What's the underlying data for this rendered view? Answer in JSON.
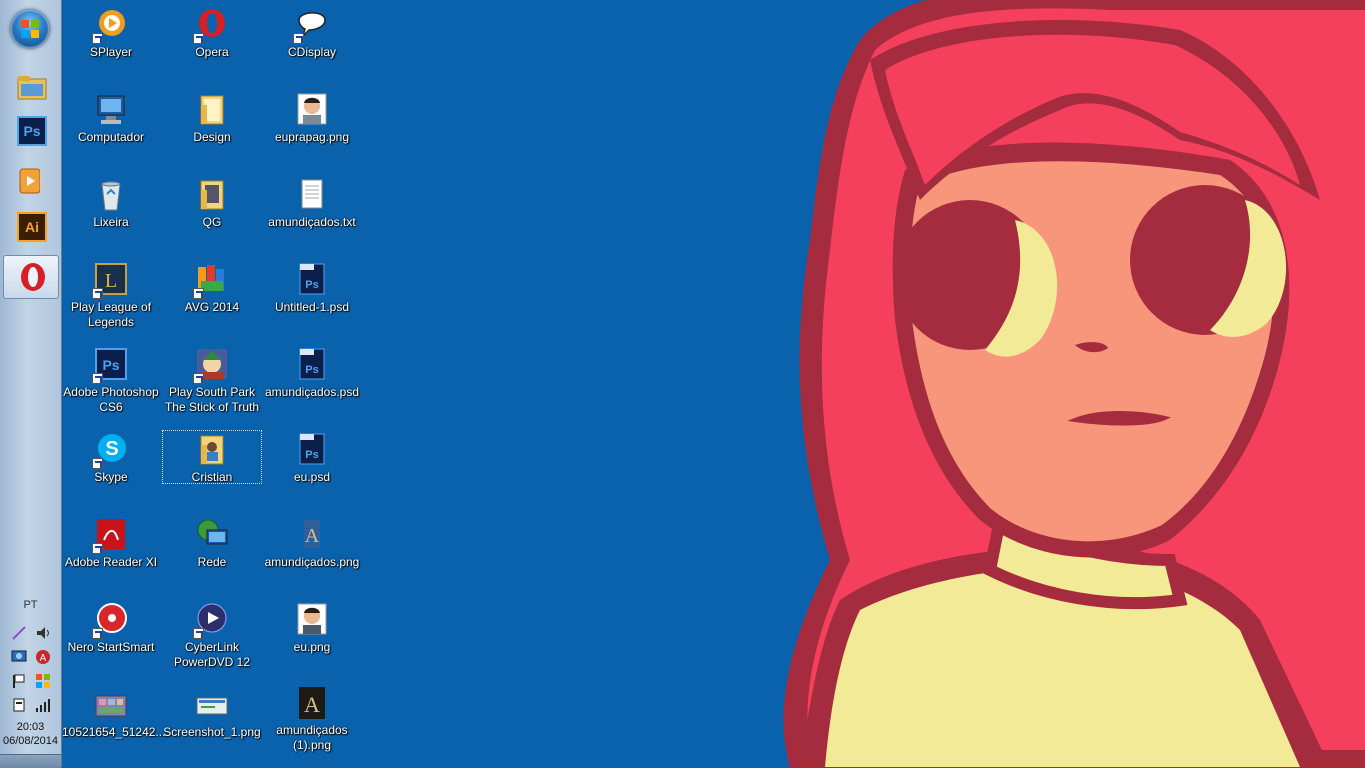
{
  "taskbar": {
    "pinned": [
      {
        "name": "explorer",
        "icon": "folder-icon"
      },
      {
        "name": "photoshop",
        "icon": "photoshop-icon",
        "glyph": "Ps"
      },
      {
        "name": "media-player",
        "icon": "media-player-icon"
      },
      {
        "name": "illustrator",
        "icon": "illustrator-icon",
        "glyph": "Ai"
      },
      {
        "name": "opera",
        "icon": "opera-icon",
        "glyph": "O"
      }
    ],
    "language": "PT",
    "clock": {
      "time": "20:03",
      "date": "06/08/2014"
    }
  },
  "desktop": {
    "icons": [
      {
        "label": "SPlayer",
        "icon": "splayer-icon",
        "shortcut": true
      },
      {
        "label": "Computador",
        "icon": "computer-icon",
        "shortcut": false
      },
      {
        "label": "Lixeira",
        "icon": "recycle-bin-icon",
        "shortcut": false
      },
      {
        "label": "Play League of Legends",
        "icon": "league-of-legends-icon",
        "shortcut": true
      },
      {
        "label": "Adobe Photoshop CS6",
        "icon": "photoshop-icon",
        "shortcut": true
      },
      {
        "label": "Skype",
        "icon": "skype-icon",
        "shortcut": true
      },
      {
        "label": "Adobe Reader XI",
        "icon": "adobe-reader-icon",
        "shortcut": true
      },
      {
        "label": "Nero StartSmart",
        "icon": "nero-icon",
        "shortcut": true
      },
      {
        "label": "10521654_51242...",
        "icon": "image-file-icon",
        "shortcut": false
      },
      {
        "label": "Opera",
        "icon": "opera-icon",
        "shortcut": true
      },
      {
        "label": "Design",
        "icon": "folder-icon",
        "shortcut": false
      },
      {
        "label": "QG",
        "icon": "folder-icon",
        "shortcut": false
      },
      {
        "label": "AVG 2014",
        "icon": "avg-icon",
        "shortcut": true
      },
      {
        "label": "Play South Park The Stick of Truth",
        "icon": "south-park-icon",
        "shortcut": true
      },
      {
        "label": "Cristian",
        "icon": "user-folder-icon",
        "shortcut": false,
        "selected": true
      },
      {
        "label": "Rede",
        "icon": "network-icon",
        "shortcut": false
      },
      {
        "label": "CyberLink PowerDVD 12",
        "icon": "powerdvd-icon",
        "shortcut": true
      },
      {
        "label": "Screenshot_1.png",
        "icon": "image-file-icon",
        "shortcut": false
      },
      {
        "label": "CDisplay",
        "icon": "cdisplay-icon",
        "shortcut": true
      },
      {
        "label": "euprapag.png",
        "icon": "portrait-image-icon",
        "shortcut": false
      },
      {
        "label": "amundiçados.txt",
        "icon": "text-file-icon",
        "shortcut": false
      },
      {
        "label": "Untitled-1.psd",
        "icon": "psd-file-icon",
        "shortcut": false
      },
      {
        "label": "amundiçados.psd",
        "icon": "psd-file-icon",
        "shortcut": false
      },
      {
        "label": "eu.psd",
        "icon": "psd-file-icon",
        "shortcut": false
      },
      {
        "label": "amundiçados.png",
        "icon": "drawing-image-icon",
        "shortcut": false
      },
      {
        "label": "eu.png",
        "icon": "portrait-image-icon",
        "shortcut": false
      },
      {
        "label": "amundiçados (1).png",
        "icon": "drawing-image-icon",
        "shortcut": false
      }
    ]
  },
  "wallpaper": {
    "subject": "cartoon girl with pink hair",
    "background": "#0a62ac"
  }
}
